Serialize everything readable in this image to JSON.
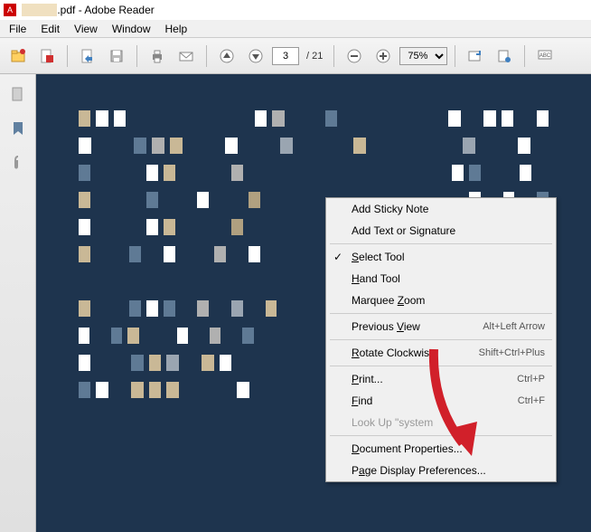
{
  "titlebar": {
    "filename_suffix": ".pdf - Adobe Reader"
  },
  "menubar": {
    "items": [
      "File",
      "Edit",
      "View",
      "Window",
      "Help"
    ]
  },
  "toolbar": {
    "page_current": "3",
    "page_total": "/ 21",
    "zoom": "75%"
  },
  "context_menu": {
    "items": [
      {
        "label": "Add Sticky Note",
        "type": "item"
      },
      {
        "label": "Add Text or Signature",
        "type": "item"
      },
      {
        "type": "sep"
      },
      {
        "label": "Select Tool",
        "type": "item",
        "checked": true,
        "u": 0
      },
      {
        "label": "Hand Tool",
        "type": "item",
        "u": 0
      },
      {
        "label": "Marquee Zoom",
        "type": "item",
        "u": 8
      },
      {
        "type": "sep"
      },
      {
        "label": "Previous View",
        "type": "item",
        "shortcut": "Alt+Left Arrow",
        "u": 9
      },
      {
        "type": "sep"
      },
      {
        "label": "Rotate Clockwise",
        "type": "item",
        "shortcut": "Shift+Ctrl+Plus",
        "u": 0
      },
      {
        "type": "sep"
      },
      {
        "label": "Print...",
        "type": "item",
        "shortcut": "Ctrl+P",
        "u": 0
      },
      {
        "label": "Find",
        "type": "item",
        "shortcut": "Ctrl+F",
        "u": 0
      },
      {
        "label": "Look Up \"system",
        "type": "item",
        "disabled": true
      },
      {
        "type": "sep"
      },
      {
        "label": "Document Properties...",
        "type": "item",
        "u": 0
      },
      {
        "label": "Page Display Preferences...",
        "type": "item",
        "u": 1
      }
    ]
  },
  "pixel_rows": [
    [
      "#c9b896",
      "#fff",
      "#fff",
      "#1e344e",
      "#1e344e",
      "#1e344e",
      "#1e344e",
      "#1e344e",
      "#1e344e",
      "#1e344e",
      "#fff",
      "#b0b0b0",
      "#1e344e",
      "#1e344e",
      "#5f7a95",
      "#1e344e",
      "#1e344e",
      "#1e344e",
      "#1e344e",
      "#1e344e",
      "#1e344e",
      "#fff",
      "#1e344e",
      "#fff",
      "#fff",
      "#1e344e",
      "#fff"
    ],
    [
      "#fff",
      "#1e344e",
      "#1e344e",
      "#5f7a95",
      "#b0b0b0",
      "#c9b896",
      "#1e344e",
      "#1e344e",
      "#fff",
      "#1e344e",
      "#1e344e",
      "#9aa5b1",
      "#1e344e",
      "#1e344e",
      "#1e344e",
      "#c9b896",
      "#1e344e",
      "#1e344e",
      "#1e344e",
      "#1e344e",
      "#1e344e",
      "#9aa5b1",
      "#1e344e",
      "#1e344e",
      "#fff",
      "#1e344e"
    ],
    [
      "#5f7a95",
      "#1e344e",
      "#1e344e",
      "#1e344e",
      "#fff",
      "#c9b896",
      "#1e344e",
      "#1e344e",
      "#1e344e",
      "#b0b0b0",
      "#1e344e",
      "#1e344e",
      "#1e344e",
      "#1e344e",
      "#1e344e",
      "#1e344e",
      "#1e344e",
      "#1e344e",
      "#1e344e",
      "#1e344e",
      "#1e344e",
      "#1e344e",
      "#fff",
      "#5f7a95",
      "#1e344e",
      "#1e344e",
      "#fff",
      "#1e344e"
    ],
    [
      "#c9b896",
      "#1e344e",
      "#1e344e",
      "#1e344e",
      "#5f7a95",
      "#1e344e",
      "#1e344e",
      "#fff",
      "#1e344e",
      "#1e344e",
      "#b0a080",
      "#1e344e",
      "#1e344e",
      "#1e344e",
      "#1e344e",
      "#1e344e",
      "#1e344e",
      "#1e344e",
      "#1e344e",
      "#1e344e",
      "#1e344e",
      "#1e344e",
      "#1e344e",
      "#fff",
      "#1e344e",
      "#fff",
      "#1e344e",
      "#5f7a95"
    ],
    [
      "#fff",
      "#1e344e",
      "#1e344e",
      "#1e344e",
      "#fff",
      "#c9b896",
      "#1e344e",
      "#1e344e",
      "#1e344e",
      "#b0a080",
      "#1e344e",
      "#1e344e",
      "#1e344e",
      "#1e344e",
      "#1e344e",
      "#1e344e",
      "#1e344e",
      "#1e344e",
      "#1e344e",
      "#1e344e",
      "#1e344e",
      "#1e344e",
      "#1e344e",
      "#1e344e",
      "#fff",
      "#b0b0b0",
      "#5f7a95",
      "#fff"
    ],
    [
      "#c9b896",
      "#1e344e",
      "#1e344e",
      "#5f7a95",
      "#1e344e",
      "#fff",
      "#1e344e",
      "#1e344e",
      "#b0b0b0",
      "#1e344e",
      "#fff",
      "#1e344e",
      "#1e344e",
      "#1e344e",
      "#1e344e",
      "#1e344e",
      "#1e344e",
      "#1e344e",
      "#1e344e",
      "#1e344e",
      "#1e344e",
      "#1e344e",
      "#1e344e",
      "#1e344e",
      "#1e344e",
      "#5f7a95",
      "#fff",
      "#fff"
    ],
    [
      "",
      "",
      "",
      "",
      "",
      "",
      "",
      "",
      "",
      "",
      "",
      "",
      "",
      "",
      "",
      "",
      "",
      "",
      "",
      "",
      "",
      "",
      "",
      "",
      "",
      "",
      "",
      ""
    ],
    [
      "#c9b896",
      "#1e344e",
      "#1e344e",
      "#5f7a95",
      "#fff",
      "#5f7a95",
      "#1e344e",
      "#b0b0b0",
      "#1e344e",
      "#9aa5b1",
      "#1e344e",
      "#c9b896",
      "#1e344e",
      "#1e344e",
      "#1e344e",
      "#1e344e",
      "#1e344e",
      "#1e344e",
      "#1e344e",
      "#1e344e",
      "#1e344e",
      "#1e344e",
      "#1e344e",
      "#1e344e",
      "#fff",
      "#1e344e",
      "#1e344e",
      "#c9b896"
    ],
    [
      "#fff",
      "#1e344e",
      "#5f7a95",
      "#c9b896",
      "#1e344e",
      "#1e344e",
      "#fff",
      "#1e344e",
      "#b0b0b0",
      "#1e344e",
      "#5f7a95",
      "#1e344e",
      "#1e344e",
      "#1e344e",
      "#1e344e",
      "#1e344e",
      "#1e344e",
      "#1e344e",
      "#1e344e",
      "#1e344e",
      "#1e344e",
      "#1e344e",
      "#1e344e",
      "#1e344e",
      "#1e344e",
      "#1e344e",
      "#c9b896",
      "#1e344e",
      "#fff"
    ],
    [
      "#fff",
      "#1e344e",
      "#1e344e",
      "#5f7a95",
      "#c9b896",
      "#9aa5b1",
      "#1e344e",
      "#c9b896",
      "#fff",
      "#1e344e",
      "#1e344e",
      "#1e344e",
      "#1e344e",
      "#1e344e",
      "#1e344e",
      "#1e344e",
      "#1e344e",
      "#1e344e",
      "#1e344e",
      "#1e344e",
      "#1e344e",
      "#1e344e",
      "#1e344e",
      "#1e344e",
      "#c9b896",
      "#fff",
      "#1e344e"
    ],
    [
      "#5f7a95",
      "#fff",
      "#1e344e",
      "#c9b896",
      "#c9b896",
      "#c9b896",
      "#1e344e",
      "#1e344e",
      "#1e344e",
      "#fff",
      "#1e344e",
      "#1e344e",
      "#1e344e",
      "#1e344e",
      "#1e344e",
      "#1e344e",
      "#1e344e",
      "#1e344e",
      "#1e344e",
      "#1e344e",
      "#1e344e",
      "#1e344e",
      "#1e344e",
      "#1e344e",
      "#1e344e",
      "#fff",
      "#c9b896"
    ]
  ]
}
